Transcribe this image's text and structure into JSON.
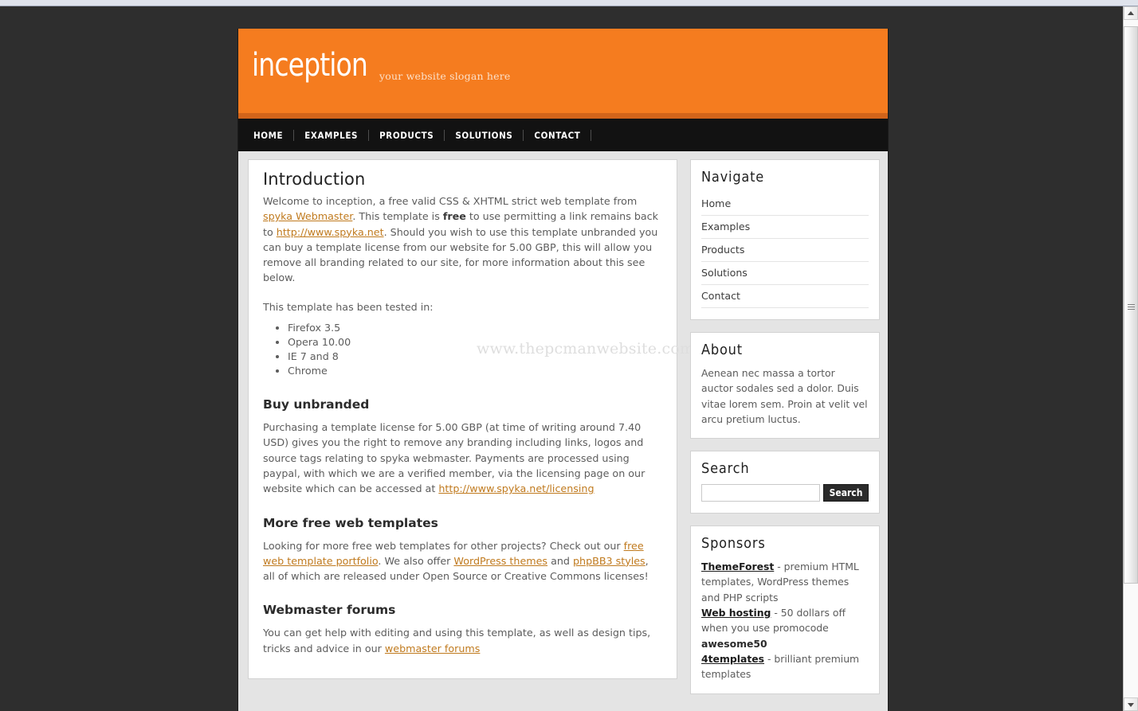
{
  "header": {
    "logo": "inception",
    "slogan": "your website slogan here"
  },
  "nav": {
    "items": [
      "HOME",
      "EXAMPLES",
      "PRODUCTS",
      "SOLUTIONS",
      "CONTACT"
    ]
  },
  "content": {
    "intro": {
      "title": "Introduction",
      "p1_a": "Welcome to inception, a free valid CSS & XHTML strict web template from ",
      "p1_link1": "spyka Webmaster",
      "p1_b": ". This template is ",
      "p1_bold": "free",
      "p1_c": " to use permitting a link remains back to ",
      "p1_link2": "http://www.spyka.net",
      "p1_d": ". Should you wish to use this template unbranded you can buy a template license from our website for 5.00 GBP, this will allow you remove all branding related to our site, for more information about this see below.",
      "p2": "This template has been tested in:",
      "browsers": [
        "Firefox 3.5",
        "Opera 10.00",
        "IE 7 and 8",
        "Chrome"
      ]
    },
    "buy": {
      "title": "Buy unbranded",
      "p_a": "Purchasing a template license for 5.00 GBP (at time of writing around 7.40 USD) gives you the right to remove any branding including links, logos and source tags relating to spyka webmaster. Payments are processed using paypal, with which we are a verified member, via the licensing page on our website which can be accessed at ",
      "p_link": "http://www.spyka.net/licensing"
    },
    "more": {
      "title": "More free web templates",
      "p_a": "Looking for more free web templates for other projects? Check out our ",
      "link1": "free web template portfolio",
      "p_b": ". We also offer ",
      "link2": "WordPress themes",
      "p_c": " and ",
      "link3": "phpBB3 styles",
      "p_d": ", all of which are released under Open Source or Creative Commons licenses!"
    },
    "forums": {
      "title": "Webmaster forums",
      "p_a": "You can get help with editing and using this template, as well as design tips, tricks and advice in our ",
      "link": "webmaster forums"
    }
  },
  "sidebar": {
    "navigate": {
      "title": "Navigate",
      "items": [
        "Home",
        "Examples",
        "Products",
        "Solutions",
        "Contact"
      ]
    },
    "about": {
      "title": "About",
      "text": "Aenean nec massa a tortor auctor sodales sed a dolor. Duis vitae lorem sem. Proin at velit vel arcu pretium luctus."
    },
    "search": {
      "title": "Search",
      "value": "",
      "placeholder": "",
      "button": "Search"
    },
    "sponsors": {
      "title": "Sponsors",
      "items": [
        {
          "name": "ThemeForest",
          "dash": " - ",
          "desc": "premium HTML templates, WordPress themes and PHP scripts",
          "code": ""
        },
        {
          "name": "Web hosting",
          "dash": " - ",
          "desc_a": "50 dollars off when you use promocode ",
          "code": "awesome50",
          "desc": ""
        },
        {
          "name": "4templates",
          "dash": " - ",
          "desc": "brilliant premium templates",
          "code": ""
        }
      ]
    }
  },
  "watermark": "www.thepcmanwebsite.com",
  "colors": {
    "brand_orange": "#f57c1f",
    "orange_shadow": "#d2641a",
    "nav_black": "#121212",
    "desktop": "#2e2e2e",
    "link": "#c07a1e",
    "page_bg": "#e4e4e4"
  }
}
